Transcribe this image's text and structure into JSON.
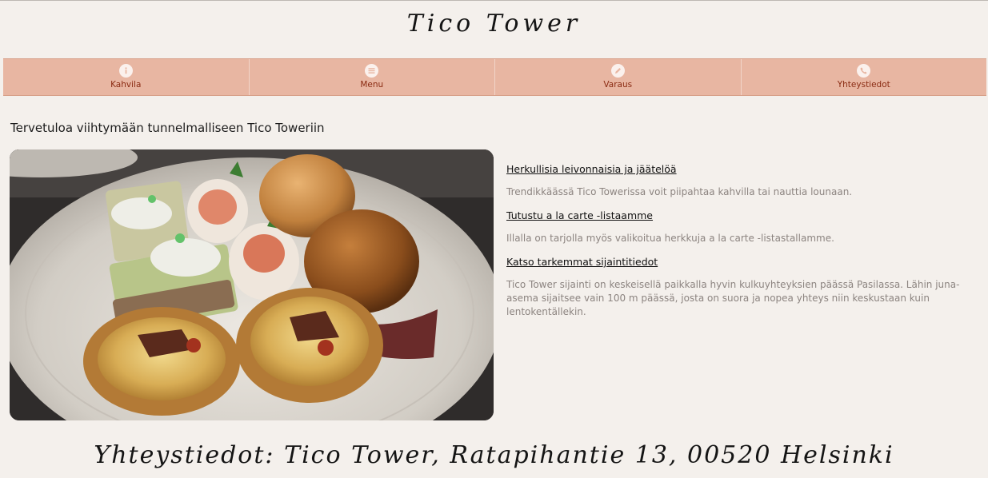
{
  "header": {
    "title": "Tico Tower"
  },
  "nav": {
    "items": [
      {
        "label": "Kahvila",
        "icon": "info-icon"
      },
      {
        "label": "Menu",
        "icon": "menu-icon"
      },
      {
        "label": "Varaus",
        "icon": "pencil-icon"
      },
      {
        "label": "Yhteystiedot",
        "icon": "phone-icon"
      }
    ]
  },
  "main": {
    "welcome": "Tervetuloa viihtymään tunnelmalliseen Tico Toweriin",
    "sections": [
      {
        "link": "Herkullisia leivonnaisia ja jäätelöä",
        "text": "Trendikkäässä Tico Towerissa voit piipahtaa kahvilla tai nauttia lounaan."
      },
      {
        "link": "Tutustu a la carte -listaamme",
        "text": "Illalla on tarjolla myös valikoitua herkkuja a la carte -listastallamme."
      },
      {
        "link": "Katso tarkemmat sijaintitiedot",
        "text": "Tico Tower sijainti on keskeisellä paikkalla hyvin kulkuyhteyksien päässä Pasilassa. Lähin juna-asema sijaitsee vain 100 m päässä, josta on suora ja nopea yhteys niin keskustaan kuin lentokentällekin."
      }
    ]
  },
  "footer": {
    "contact": "Yhteystiedot: Tico Tower,  Ratapihantie 13,  00520 Helsinki"
  },
  "colors": {
    "nav_bg": "#e8b6a2",
    "nav_label": "#8a2b12",
    "page_bg": "#f4f0ec"
  }
}
